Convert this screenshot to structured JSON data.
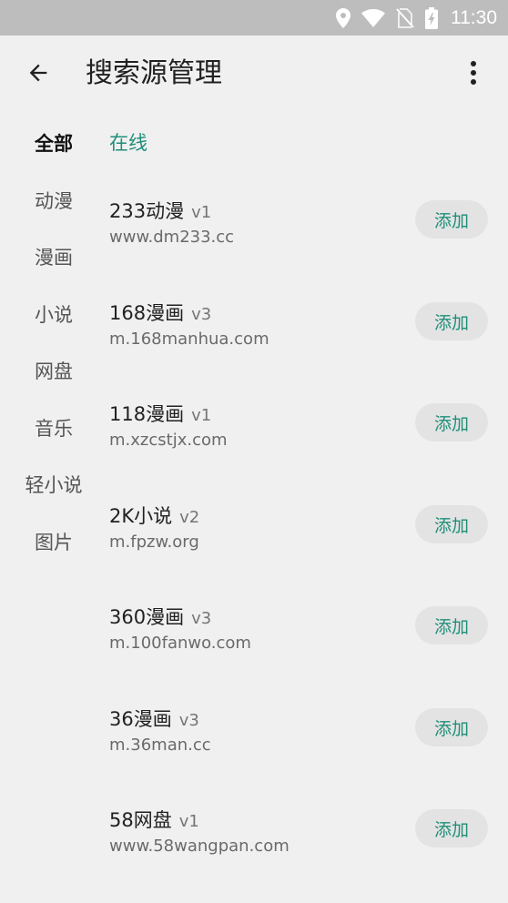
{
  "status_bar": {
    "time": "11:30",
    "icons": [
      "location-icon",
      "wifi-icon",
      "no-sim-icon",
      "battery-charging-icon"
    ]
  },
  "toolbar": {
    "back_icon": "arrow-back-icon",
    "title": "搜索源管理",
    "more_icon": "more-vert-icon"
  },
  "categories": [
    {
      "label": "全部",
      "active": true
    },
    {
      "label": "动漫",
      "active": false
    },
    {
      "label": "漫画",
      "active": false
    },
    {
      "label": "小说",
      "active": false
    },
    {
      "label": "网盘",
      "active": false
    },
    {
      "label": "音乐",
      "active": false
    },
    {
      "label": "轻小说",
      "active": false
    },
    {
      "label": "图片",
      "active": false
    }
  ],
  "section": {
    "header": "在线"
  },
  "sources": [
    {
      "name": "233动漫",
      "version": "v1",
      "url": "www.dm233.cc",
      "button_label": "添加"
    },
    {
      "name": "168漫画",
      "version": "v3",
      "url": "m.168manhua.com",
      "button_label": "添加"
    },
    {
      "name": "118漫画",
      "version": "v1",
      "url": "m.xzcstjx.com",
      "button_label": "添加"
    },
    {
      "name": "2K小说",
      "version": "v2",
      "url": "m.fpzw.org",
      "button_label": "添加"
    },
    {
      "name": "360漫画",
      "version": "v3",
      "url": "m.100fanwo.com",
      "button_label": "添加"
    },
    {
      "name": "36漫画",
      "version": "v3",
      "url": "m.36man.cc",
      "button_label": "添加"
    },
    {
      "name": "58网盘",
      "version": "v1",
      "url": "www.58wangpan.com",
      "button_label": "添加"
    }
  ],
  "colors": {
    "accent": "#1f8f7a",
    "background": "#f0f0f0",
    "status_bar": "#bdbdbd",
    "button_bg": "#e3e3e3"
  }
}
